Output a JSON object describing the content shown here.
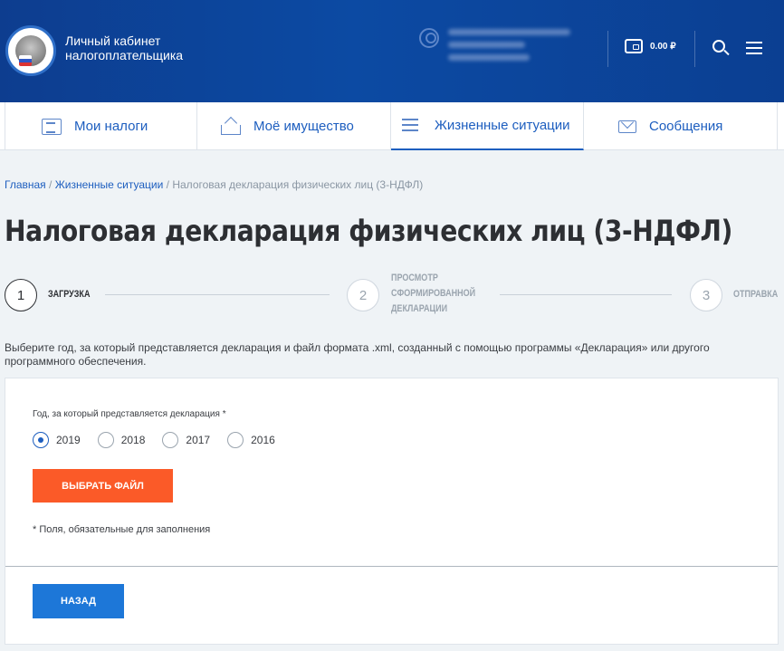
{
  "header": {
    "brand_line1": "Личный кабинет",
    "brand_line2": "налогоплательщика",
    "balance": "0.00 ₽",
    "icons": [
      "emblem-logo",
      "user-icon",
      "wallet-icon",
      "search-icon",
      "menu-icon"
    ]
  },
  "nav": {
    "items": [
      {
        "label": "Мои налоги",
        "icon": "taxes-icon"
      },
      {
        "label": "Моё имущество",
        "icon": "property-icon"
      },
      {
        "label": "Жизненные ситуации",
        "icon": "list-icon"
      },
      {
        "label": "Сообщения",
        "icon": "envelope-icon"
      }
    ],
    "active_index": 2
  },
  "breadcrumb": {
    "home": "Главная",
    "sep1": " / ",
    "section": "Жизненные ситуации",
    "sep2": " / ",
    "current": "Налоговая декларация физических лиц (3-НДФЛ)"
  },
  "page_title": "Налоговая декларация физических лиц (3-НДФЛ)",
  "stepper": {
    "steps": [
      {
        "num": "1",
        "label": "Загрузка"
      },
      {
        "num": "2",
        "label_l1": "Просмотр",
        "label_l2": "сформированной",
        "label_l3": "декларации"
      },
      {
        "num": "3",
        "label": "Отправка"
      }
    ],
    "current": 1
  },
  "description": "Выберите год, за который представляется декларация и файл формата .xml, созданный с помощью программы «Декларация» или другого программного обеспечения.",
  "form": {
    "year_label": "Год, за который представляется декларация *",
    "years": [
      "2019",
      "2018",
      "2017",
      "2016"
    ],
    "selected_year": "2019",
    "choose_file_button": "ВЫБРАТЬ ФАЙЛ",
    "required_note": "* Поля, обязательные для заполнения",
    "back_button": "НАЗАД"
  },
  "colors": {
    "header_bg": "#0c4aa3",
    "link": "#1d5ebf",
    "primary_orange": "#fb5a28",
    "primary_blue": "#1d77d8"
  }
}
